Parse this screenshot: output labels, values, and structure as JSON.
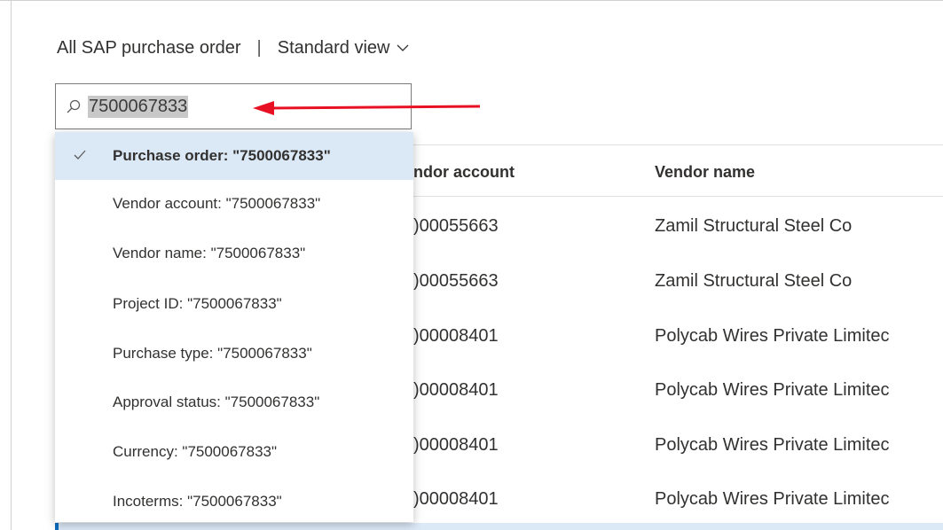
{
  "header": {
    "title": "All SAP purchase order",
    "separator": "|",
    "view_label": "Standard view"
  },
  "search": {
    "value": "7500067833",
    "icon": "search-icon"
  },
  "grid": {
    "columns": [
      {
        "label": "ndor account"
      },
      {
        "label": "Vendor name"
      }
    ],
    "rows": [
      {
        "vendor_account": ")00055663",
        "vendor_name": "Zamil Structural Steel Co"
      },
      {
        "vendor_account": ")00055663",
        "vendor_name": "Zamil Structural Steel Co"
      },
      {
        "vendor_account": ")00008401",
        "vendor_name": "Polycab Wires Private Limitec"
      },
      {
        "vendor_account": ")00008401",
        "vendor_name": "Polycab Wires Private Limitec"
      },
      {
        "vendor_account": ")00008401",
        "vendor_name": "Polycab Wires Private Limitec"
      },
      {
        "vendor_account": ")00008401",
        "vendor_name": "Polycab Wires Private Limitec"
      }
    ]
  },
  "dropdown": {
    "items": [
      {
        "label": "Purchase order: \"7500067833\"",
        "selected": true
      },
      {
        "label": "Vendor account: \"7500067833\"",
        "selected": false
      },
      {
        "label": "Vendor name: \"7500067833\"",
        "selected": false
      },
      {
        "label": "Project ID: \"7500067833\"",
        "selected": false
      },
      {
        "label": "Purchase type: \"7500067833\"",
        "selected": false
      },
      {
        "label": "Approval status: \"7500067833\"",
        "selected": false
      },
      {
        "label": "Currency: \"7500067833\"",
        "selected": false
      },
      {
        "label": "Incoterms: \"7500067833\"",
        "selected": false
      }
    ]
  },
  "colors": {
    "selected_bg": "#dbe8f6",
    "accent": "#0f6cbd",
    "arrow": "#e81123"
  }
}
